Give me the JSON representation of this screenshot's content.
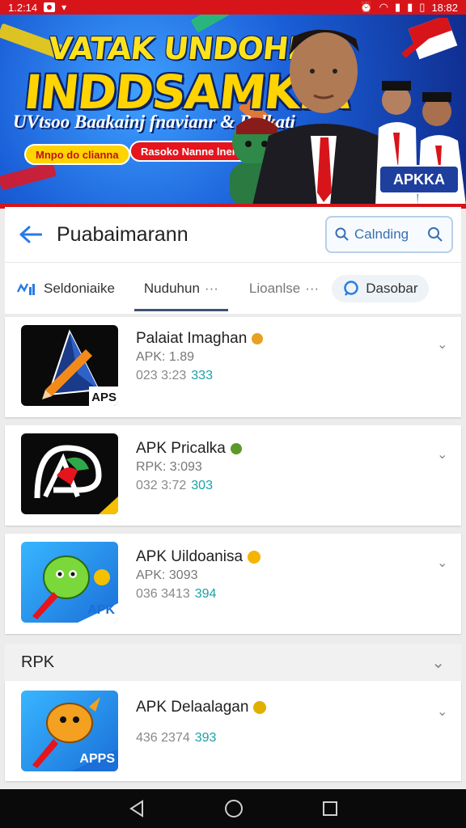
{
  "status_bar": {
    "left_text": "1.2:14",
    "right_text": "18:82"
  },
  "banner": {
    "title_line1": "VATAK UNDOHIAN",
    "title_line2": "INDDSAMKIA",
    "subtitle": "UVtsoo Baakainj fnavianr & Balkati",
    "pill_left": "Mnpo do clianna",
    "pill_right": "Rasoko Nanne lnere",
    "badge": "APKKA"
  },
  "header": {
    "title": "Puabaimarann",
    "search_label": "Calnding"
  },
  "tabs": [
    {
      "label": "Seldoniaike"
    },
    {
      "label": "Nuduhun"
    },
    {
      "label": "Lioanlse"
    },
    {
      "label": "Dasobar"
    }
  ],
  "apps": [
    {
      "name": "Palaiat Imaghan",
      "meta": "APK: 1.89",
      "size": "023 3:23",
      "size_highlight": "333"
    },
    {
      "name": "APK Pricalka",
      "meta": "RPK: 3:093",
      "size": "032 3:72",
      "size_highlight": "303"
    },
    {
      "name": "APK Uildoanisa",
      "meta": "APK: 3093",
      "size": "036 3413",
      "size_highlight": "394"
    }
  ],
  "section": {
    "title": "RPK"
  },
  "apps_section": [
    {
      "name": "APK Delaalagan",
      "size": "436 2374",
      "size_highlight": "393"
    }
  ],
  "icon_labels": {
    "apps": "APPS",
    "apk": "APK",
    "aps": "APS"
  },
  "colors": {
    "accent_red": "#d8141b",
    "link_blue": "#3a6fb0",
    "teal": "#1aa1a8"
  }
}
